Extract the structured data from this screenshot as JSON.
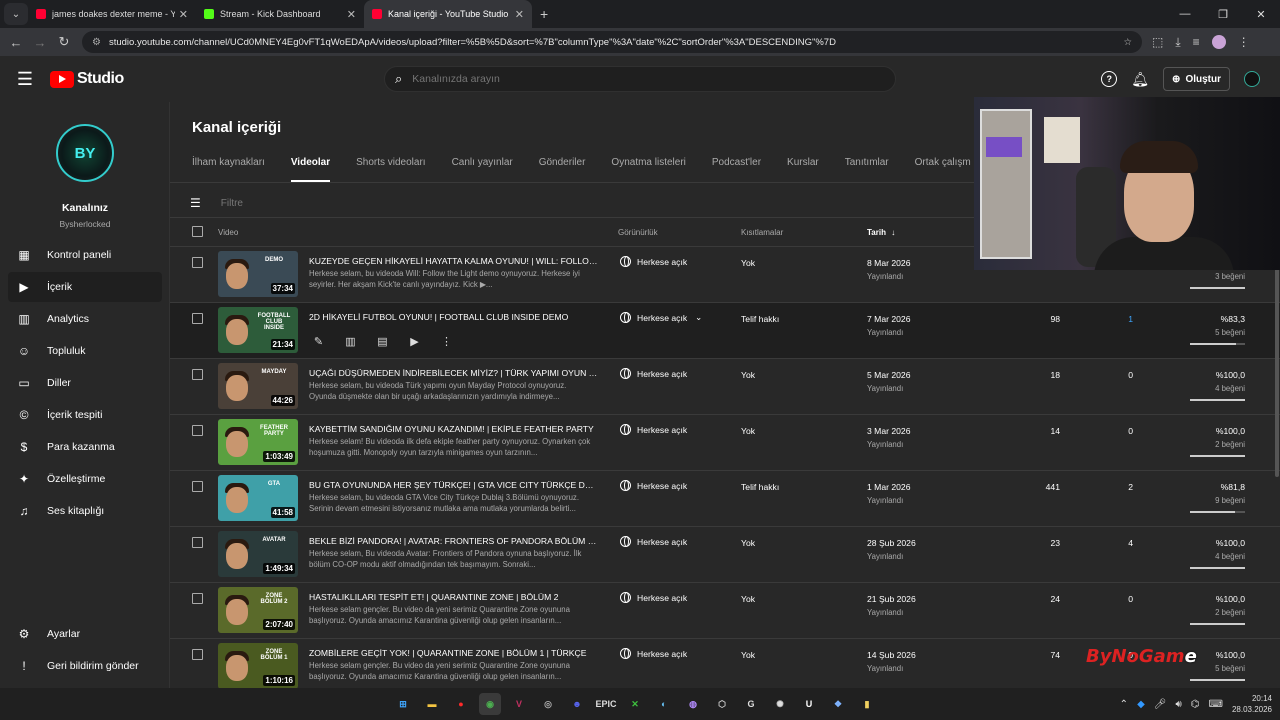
{
  "browser": {
    "tabs": [
      {
        "title": "james doakes dexter meme - Yo",
        "fav_color": "#ff0033"
      },
      {
        "title": "Stream - Kick Dashboard",
        "fav_color": "#53fc18"
      },
      {
        "title": "Kanal içeriği - YouTube Studio",
        "fav_color": "#ff0033"
      }
    ],
    "url": "studio.youtube.com/channel/UCd0MNEY4Eg0vFT1qWoEDApA/videos/upload?filter=%5B%5D&sort=%7B\"columnType\"%3A\"date\"%2C\"sortOrder\"%3A\"DESCENDING\"%7D"
  },
  "header": {
    "logo_text": "Studio",
    "search_placeholder": "Kanalınızda arayın",
    "create_label": "Oluştur"
  },
  "channel": {
    "avatar_text": "BY",
    "name": "Kanalınız",
    "handle": "Bysherlocked"
  },
  "sidebar": {
    "items": [
      {
        "label": "Kontrol paneli",
        "icon": "dashboard-icon",
        "glyph": "▦"
      },
      {
        "label": "İçerik",
        "icon": "content-icon",
        "glyph": "▶"
      },
      {
        "label": "Analytics",
        "icon": "analytics-icon",
        "glyph": "▥"
      },
      {
        "label": "Topluluk",
        "icon": "community-icon",
        "glyph": "☺"
      },
      {
        "label": "Diller",
        "icon": "subtitles-icon",
        "glyph": "▭"
      },
      {
        "label": "İçerik tespiti",
        "icon": "copyright-icon",
        "glyph": "©"
      },
      {
        "label": "Para kazanma",
        "icon": "dollar-icon",
        "glyph": "$"
      },
      {
        "label": "Özelleştirme",
        "icon": "wand-icon",
        "glyph": "✦"
      },
      {
        "label": "Ses kitaplığı",
        "icon": "audio-library-icon",
        "glyph": "♫"
      }
    ],
    "bottom": [
      {
        "label": "Ayarlar",
        "icon": "settings-icon",
        "glyph": "⚙"
      },
      {
        "label": "Geri bildirim gönder",
        "icon": "feedback-icon",
        "glyph": "!"
      }
    ]
  },
  "page": {
    "title": "Kanal içeriği",
    "tabs": [
      "İlham kaynakları",
      "Videolar",
      "Shorts videoları",
      "Canlı yayınlar",
      "Gönderiler",
      "Oynatma listeleri",
      "Podcast'ler",
      "Kurslar",
      "Tanıtımlar",
      "Ortak çalışm"
    ],
    "active_tab": "Videolar",
    "filter_placeholder": "Filtre",
    "columns": {
      "video": "Video",
      "visibility": "Görünürlük",
      "restrictions": "Kısıtlamalar",
      "date": "Tarih"
    }
  },
  "videos": [
    {
      "title": "KUZEYDE GEÇEN HİKAYELİ HAYATTA KALMA OYUNU! | WILL: FOLLOW ...",
      "desc": "Herkese selam, bu videoda Will: Follow the Light demo oynuyoruz. Herkese iyi seyirler. Her akşam Kick'te canlı yayındayız. Kick ▶...",
      "duration": "37:34",
      "visibility": "Herkese açık",
      "restriction": "Yok",
      "date": "8 Mar 2026",
      "date_sub": "Yayınlandı",
      "views": "",
      "comments": "",
      "pct": "",
      "likes": "3 beğeni",
      "like_ratio": 1.0,
      "thumb_bg": "#3a4a55",
      "cap": "DEMO"
    },
    {
      "title": "2D HİKAYELİ FUTBOL OYUNU! | FOOTBALL CLUB INSIDE DEMO",
      "desc": "",
      "duration": "21:34",
      "visibility": "Herkese açık",
      "restriction": "Telif hakkı",
      "date": "7 Mar 2026",
      "date_sub": "Yayınlandı",
      "views": "98",
      "comments": "1",
      "pct": "%83,3",
      "likes": "5 beğeni",
      "like_ratio": 0.833,
      "thumb_bg": "#2d5c3a",
      "cap": "FOOTBALL CLUB INSIDE"
    },
    {
      "title": "UÇAĞI DÜŞÜRMEDEN İNDİREBİLECEK MİYİZ? | TÜRK YAPIMI OYUN MA...",
      "desc": "Herkese selam, bu videoda Türk yapımı oyun Mayday Protocol oynuyoruz. Oyunda düşmekte olan bir uçağı arkadaşlarınızın yardımıyla indirmeye...",
      "duration": "44:26",
      "visibility": "Herkese açık",
      "restriction": "Yok",
      "date": "5 Mar 2026",
      "date_sub": "Yayınlandı",
      "views": "18",
      "comments": "0",
      "pct": "%100,0",
      "likes": "4 beğeni",
      "like_ratio": 1.0,
      "thumb_bg": "#4a4038",
      "cap": "MAYDAY"
    },
    {
      "title": "KAYBETTİM SANDIĞIM OYUNU KAZANDIM! | EKİPLE FEATHER PARTY",
      "desc": "Herkese selam! Bu videoda ilk defa ekiple feather party oynuyoruz. Oynarken çok hoşumuza gitti. Monopoly oyun tarzıyla minigames oyun tarzının...",
      "duration": "1:03:49",
      "visibility": "Herkese açık",
      "restriction": "Yok",
      "date": "3 Mar 2026",
      "date_sub": "Yayınlandı",
      "views": "14",
      "comments": "0",
      "pct": "%100,0",
      "likes": "2 beğeni",
      "like_ratio": 1.0,
      "thumb_bg": "#5aa040",
      "cap": "FEATHER PARTY"
    },
    {
      "title": "BU GTA OYUNUNDA HER ŞEY TÜRKÇE! | GTA VICE CITY TÜRKÇE DUBLA...",
      "desc": "Herkese selam, bu videoda GTA Vice City Türkçe Dublaj 3.Bölümü oynuyoruz. Serinin devam etmesini istiyorsanız mutlaka ama mutlaka yorumlarda belirti...",
      "duration": "41:58",
      "visibility": "Herkese açık",
      "restriction": "Telif hakkı",
      "date": "1 Mar 2026",
      "date_sub": "Yayınlandı",
      "views": "441",
      "comments": "2",
      "pct": "%81,8",
      "likes": "9 beğeni",
      "like_ratio": 0.818,
      "thumb_bg": "#3fa0a8",
      "cap": "GTA"
    },
    {
      "title": "BEKLE BİZİ PANDORA! | AVATAR: FRONTIERS OF PANDORA BÖLÜM 1 | ...",
      "desc": "Herkese selam, Bu videoda Avatar: Frontiers of Pandora oynuna başlıyoruz. İlk bölüm CO-OP modu aktif olmadığından tek başımayım. Sonraki...",
      "duration": "1:49:34",
      "visibility": "Herkese açık",
      "restriction": "Yok",
      "date": "28 Şub 2026",
      "date_sub": "Yayınlandı",
      "views": "23",
      "comments": "4",
      "pct": "%100,0",
      "likes": "4 beğeni",
      "like_ratio": 1.0,
      "thumb_bg": "#2a3a3a",
      "cap": "AVATAR"
    },
    {
      "title": "HASTALIKLILARI TESPİT ET! | QUARANTINE ZONE | BÖLÜM 2",
      "desc": "Herkese selam gençler. Bu video da yeni serimiz Quarantine Zone oyununa başlıyoruz. Oyunda amacımız Karantina güvenliği olup gelen insanların...",
      "duration": "2:07:40",
      "visibility": "Herkese açık",
      "restriction": "Yok",
      "date": "21 Şub 2026",
      "date_sub": "Yayınlandı",
      "views": "24",
      "comments": "0",
      "pct": "%100,0",
      "likes": "2 beğeni",
      "like_ratio": 1.0,
      "thumb_bg": "#5a6a2a",
      "cap": "ZONE BÖLÜM 2"
    },
    {
      "title": "ZOMBİLERE GEÇİT YOK! | QUARANTINE ZONE | BÖLÜM 1 | TÜRKÇE",
      "desc": "Herkese selam gençler. Bu video da yeni serimiz Quarantine Zone oyununa başlıyoruz. Oyunda amacımız Karantina güvenliği olup gelen insanların...",
      "duration": "1:10:16",
      "visibility": "Herkese açık",
      "restriction": "Yok",
      "date": "14 Şub 2026",
      "date_sub": "Yayınlandı",
      "views": "74",
      "comments": "0",
      "pct": "%100,0",
      "likes": "5 beğeni",
      "like_ratio": 1.0,
      "thumb_bg": "#4a5a20",
      "cap": "ZONE BÖLÜM 1"
    }
  ],
  "watermark": {
    "text_a": "ByNoGam",
    "text_b": "e"
  },
  "taskbar": {
    "time": "20:14",
    "date": "28.03.2026",
    "apps": [
      {
        "name": "windows-start-icon",
        "glyph": "⊞",
        "color": "#3fa7ff"
      },
      {
        "name": "file-explorer-icon",
        "glyph": "▬",
        "color": "#f4c542"
      },
      {
        "name": "youtube-music-icon",
        "glyph": "●",
        "color": "#ff2a2a"
      },
      {
        "name": "chrome-icon",
        "glyph": "◉",
        "color": "#4caf50"
      },
      {
        "name": "vegas-icon",
        "glyph": "V",
        "color": "#c03060"
      },
      {
        "name": "obs-icon",
        "glyph": "◎",
        "color": "#aaaaaa"
      },
      {
        "name": "discord-icon",
        "glyph": "☻",
        "color": "#5865f2"
      },
      {
        "name": "epic-games-icon",
        "glyph": "EPIC",
        "color": "#dddddd"
      },
      {
        "name": "xbox-icon",
        "glyph": "✕",
        "color": "#3ec13e"
      },
      {
        "name": "steam-icon",
        "glyph": "◐",
        "color": "#66c0f4"
      },
      {
        "name": "github-icon",
        "glyph": "◍",
        "color": "#b48cff"
      },
      {
        "name": "cube-app-icon",
        "glyph": "⬡",
        "color": "#cccccc"
      },
      {
        "name": "g-app-icon",
        "glyph": "G",
        "color": "#dddddd"
      },
      {
        "name": "gear-app-icon",
        "glyph": "✺",
        "color": "#dddddd"
      },
      {
        "name": "unreal-icon",
        "glyph": "U",
        "color": "#ffffff"
      },
      {
        "name": "network-app-icon",
        "glyph": "❖",
        "color": "#7fb4ff"
      },
      {
        "name": "notes-app-icon",
        "glyph": "▮",
        "color": "#f0d060"
      }
    ]
  }
}
